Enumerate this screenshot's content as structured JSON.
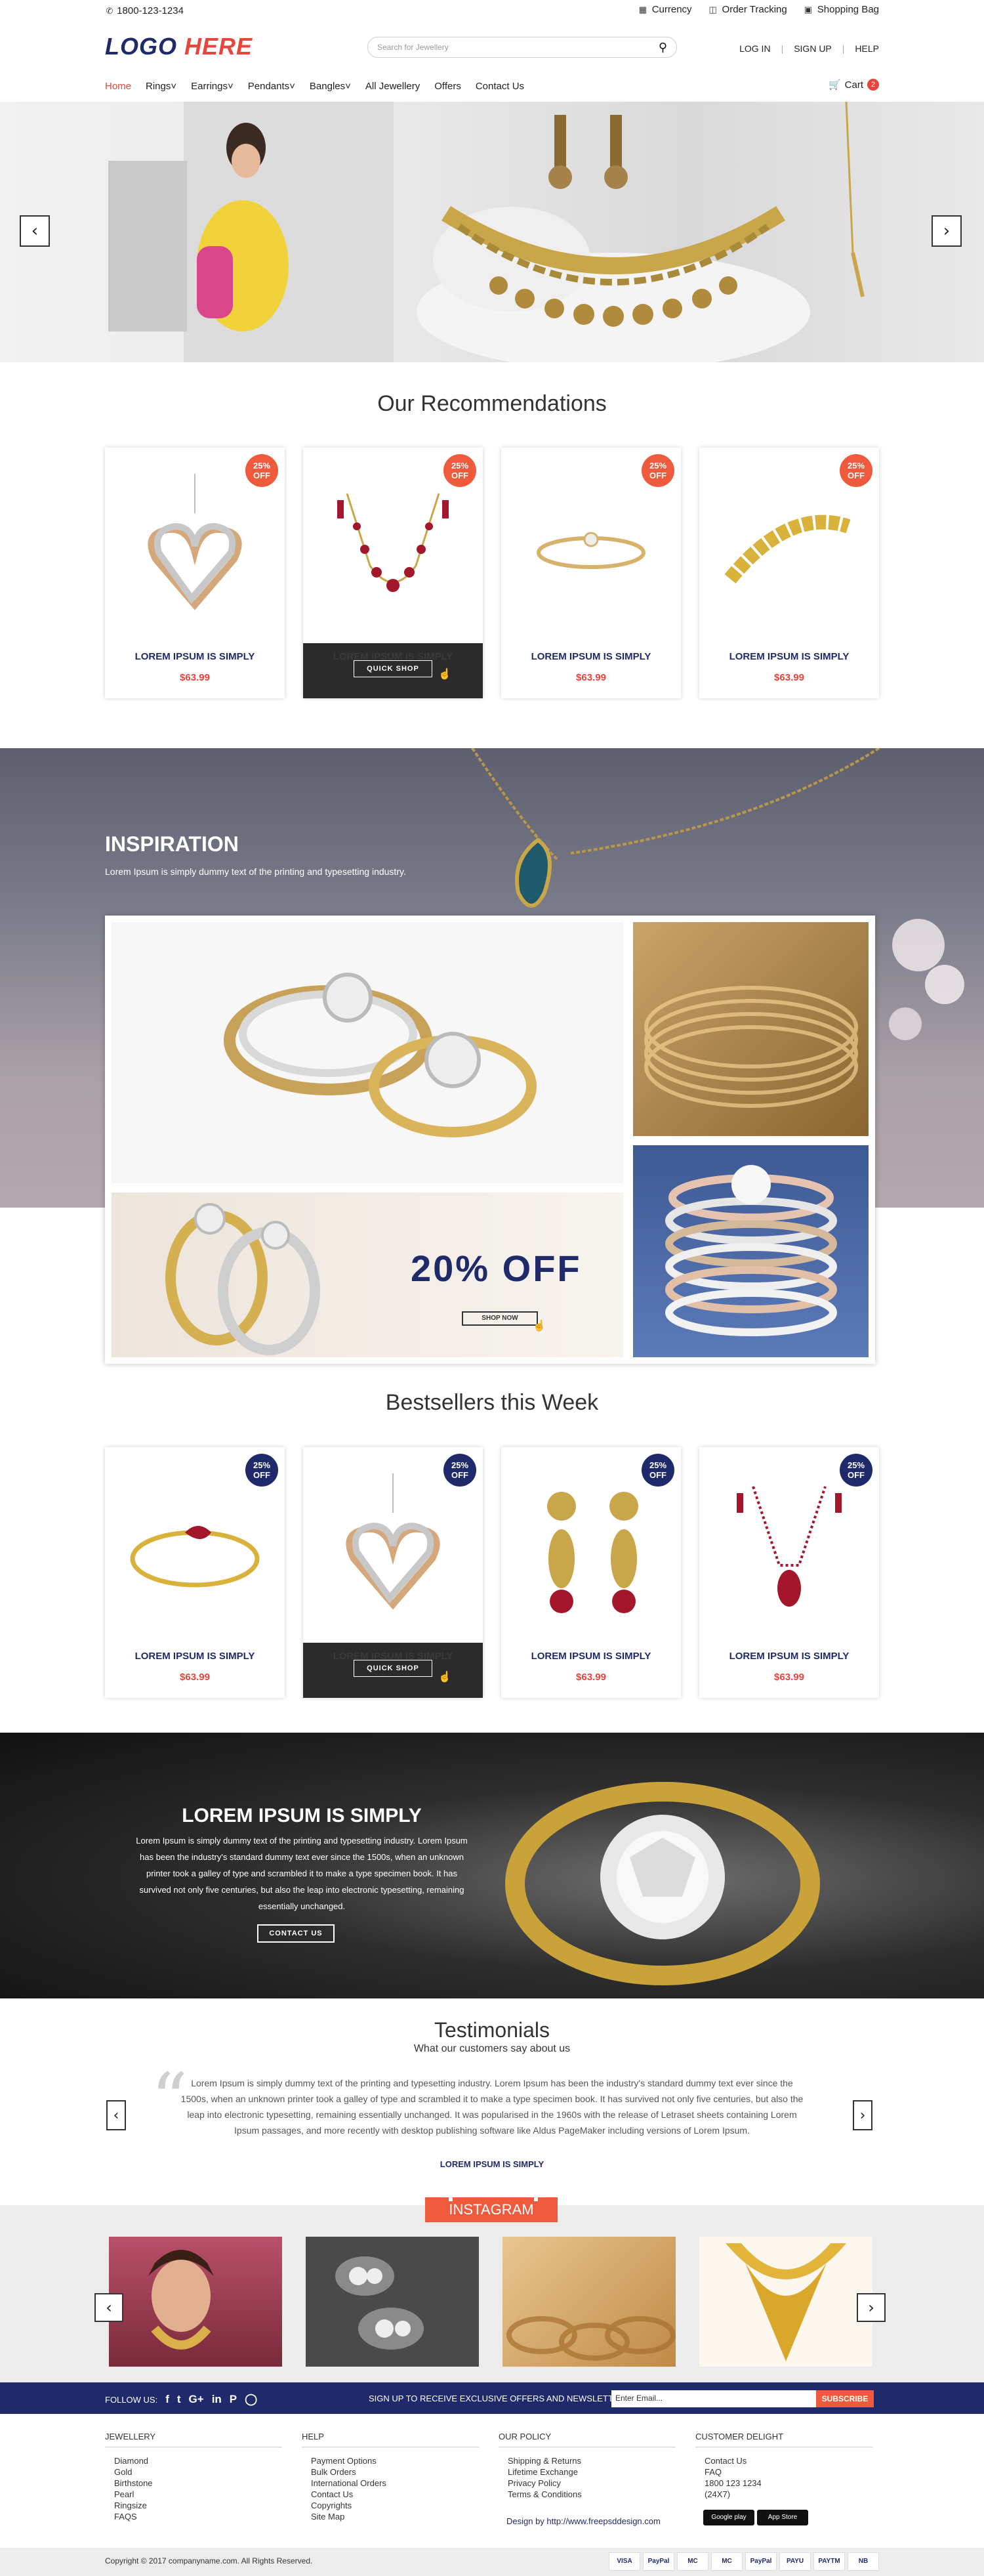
{
  "topbar": {
    "phone": "1800-123-1234",
    "currency": "Currency",
    "order_tracking": "Order Tracking",
    "shopping_bag": "Shopping Bag"
  },
  "header": {
    "logo_part1": "LOGO",
    "logo_part2": "HERE",
    "search_placeholder": "Search for Jewellery",
    "login": "LOG IN",
    "signup": "SIGN UP",
    "help": "HELP"
  },
  "nav": {
    "items": [
      "Home",
      "Rings",
      "Earrings",
      "Pendants",
      "Bangles",
      "All Jewellery",
      "Offers",
      "Contact Us"
    ],
    "cart": "Cart",
    "cart_count": "2"
  },
  "recommendations": {
    "title": "Our Recommendations",
    "products": [
      {
        "discount": "25%",
        "off": "OFF",
        "name": "LOREM IPSUM IS SIMPLY",
        "price": "$63.99"
      },
      {
        "discount": "25%",
        "off": "OFF",
        "name": "LOREM IPSUM IS SIMPLY",
        "price": "$63.99",
        "quick_shop": "QUICK SHOP"
      },
      {
        "discount": "25%",
        "off": "OFF",
        "name": "LOREM IPSUM IS SIMPLY",
        "price": "$63.99"
      },
      {
        "discount": "25%",
        "off": "OFF",
        "name": "LOREM IPSUM IS SIMPLY",
        "price": "$63.99"
      }
    ]
  },
  "inspiration": {
    "title": "INSPIRATION",
    "subtitle": "Lorem Ipsum is simply dummy text of the printing and typesetting industry.",
    "offer": "20% OFF",
    "shop_now": "SHOP NOW"
  },
  "bestsellers": {
    "title": "Bestsellers this Week",
    "products": [
      {
        "discount": "25%",
        "off": "OFF",
        "name": "LOREM IPSUM IS SIMPLY",
        "price": "$63.99"
      },
      {
        "discount": "25%",
        "off": "OFF",
        "name": "LOREM IPSUM IS SIMPLY",
        "price": "$63.99",
        "quick_shop": "QUICK SHOP"
      },
      {
        "discount": "25%",
        "off": "OFF",
        "name": "LOREM IPSUM IS SIMPLY",
        "price": "$63.99"
      },
      {
        "discount": "25%",
        "off": "OFF",
        "name": "LOREM IPSUM IS SIMPLY",
        "price": "$63.99"
      }
    ]
  },
  "promo": {
    "title": "LOREM IPSUM IS SIMPLY",
    "text": "Lorem Ipsum is simply dummy text of the printing and typesetting industry. Lorem Ipsum has been the industry's standard dummy text ever since the 1500s, when an unknown printer took a galley of type and scrambled it to make a type specimen book. It has survived not only five centuries, but also the leap into electronic typesetting, remaining essentially unchanged.",
    "button": "CONTACT US"
  },
  "testimonials": {
    "title": "Testimonials",
    "subtitle": "What our customers say about us",
    "text": "Lorem Ipsum is simply dummy text of the printing and typesetting industry. Lorem Ipsum has been the industry's standard dummy text ever since the 1500s, when an unknown printer took a galley of type and scrambled it to make a type specimen book. It has survived not only five centuries, but also the leap into electronic typesetting, remaining essentially unchanged. It was popularised in the 1960s with the release of Letraset sheets containing Lorem Ipsum passages, and more recently with desktop publishing software like Aldus PageMaker including versions of Lorem Ipsum.",
    "name": "LOREM IPSUM IS SIMPLY"
  },
  "instagram": {
    "label": "INSTAGRAM"
  },
  "newsletter": {
    "follow": "FOLLOW US:",
    "text": "SIGN UP TO RECEIVE EXCLUSIVE OFFERS AND NEWSLETTERS",
    "email_placeholder": "Enter Email...",
    "subscribe": "SUBSCRIBE"
  },
  "footer": {
    "jewellery": {
      "title": "JEWELLERY",
      "items": [
        "Diamond",
        "Gold",
        "Birthstone",
        "Pearl",
        "Ringsize",
        "FAQS"
      ]
    },
    "help": {
      "title": "HELP",
      "items": [
        "Payment Options",
        "Bulk Orders",
        "International Orders",
        "Contact Us",
        "Copyrights",
        "Site Map"
      ]
    },
    "policy": {
      "title": "OUR POLICY",
      "items": [
        "Shipping & Returns",
        "Lifetime Exchange",
        "Privacy Policy",
        "Terms & Conditions"
      ],
      "design": "Design by http://www.freepsddesign.com"
    },
    "delight": {
      "title": "CUSTOMER DELIGHT",
      "items": [
        "Contact Us",
        "FAQ",
        "1800 123 1234",
        "(24X7)"
      ],
      "google_play": "Google play",
      "app_store": "App Store"
    },
    "copyright": "Copyright © 2017 companyname.com. All Rights Reserved.",
    "payments": [
      "VISA",
      "PayPal",
      "MC",
      "MC",
      "PayPal",
      "PAYU",
      "PAYTM",
      "NB"
    ]
  },
  "colors": {
    "navy": "#1f2a6b",
    "accent": "#e8453c",
    "badge_red": "#f05a3c"
  }
}
